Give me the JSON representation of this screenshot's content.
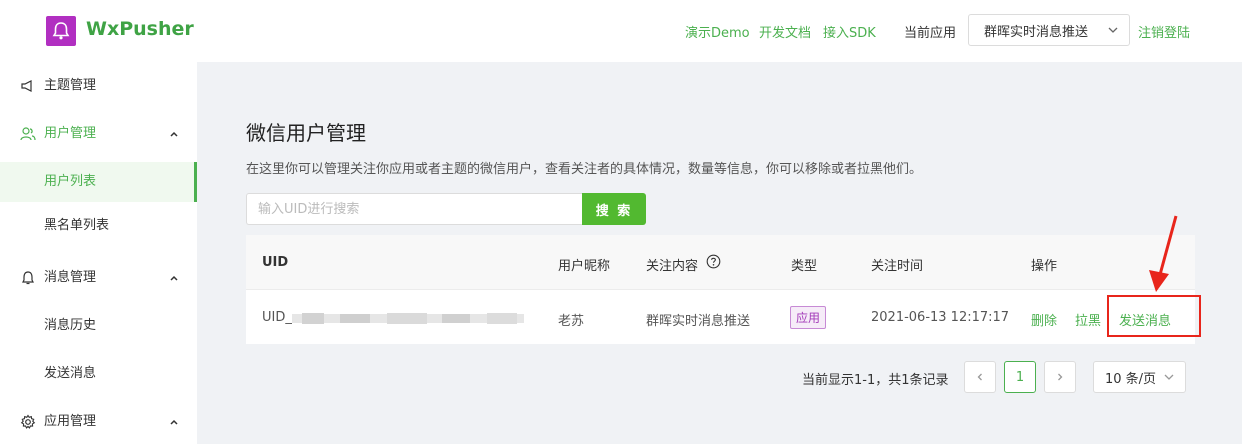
{
  "header": {
    "app_name": "WxPusher",
    "nav": [
      "演示Demo",
      "开发文档",
      "接入SDK"
    ],
    "current_app_label": "当前应用",
    "current_app_value": "群晖实时消息推送",
    "logout": "注销登陆"
  },
  "sidebar": {
    "topic_manage": "主题管理",
    "user_manage": "用户管理",
    "user_list": "用户列表",
    "blacklist": "黑名单列表",
    "message_manage": "消息管理",
    "message_history": "消息历史",
    "send_message": "发送消息",
    "app_manage": "应用管理"
  },
  "page": {
    "title": "微信用户管理",
    "description": "在这里你可以管理关注你应用或者主题的微信用户，查看关注者的具体情况，数量等信息，你可以移除或者拉黑他们。",
    "search_placeholder": "输入UID进行搜索",
    "search_button": "搜 索"
  },
  "table": {
    "columns": [
      "UID",
      "用户昵称",
      "关注内容",
      "类型",
      "关注时间",
      "操作"
    ],
    "rows": [
      {
        "uid": "UID_",
        "nickname": "老苏",
        "content": "群晖实时消息推送",
        "type": "应用",
        "time": "2021-06-13 12:17:17",
        "actions": [
          "删除",
          "拉黑",
          "发送消息"
        ]
      }
    ]
  },
  "pagination": {
    "summary": "当前显示1-1，共1条记录",
    "current_page": "1",
    "page_size": "10 条/页"
  },
  "colors": {
    "brand_green": "#4bb04f",
    "logo_purple": "#b12fc1",
    "highlight_red": "#e8251b"
  }
}
